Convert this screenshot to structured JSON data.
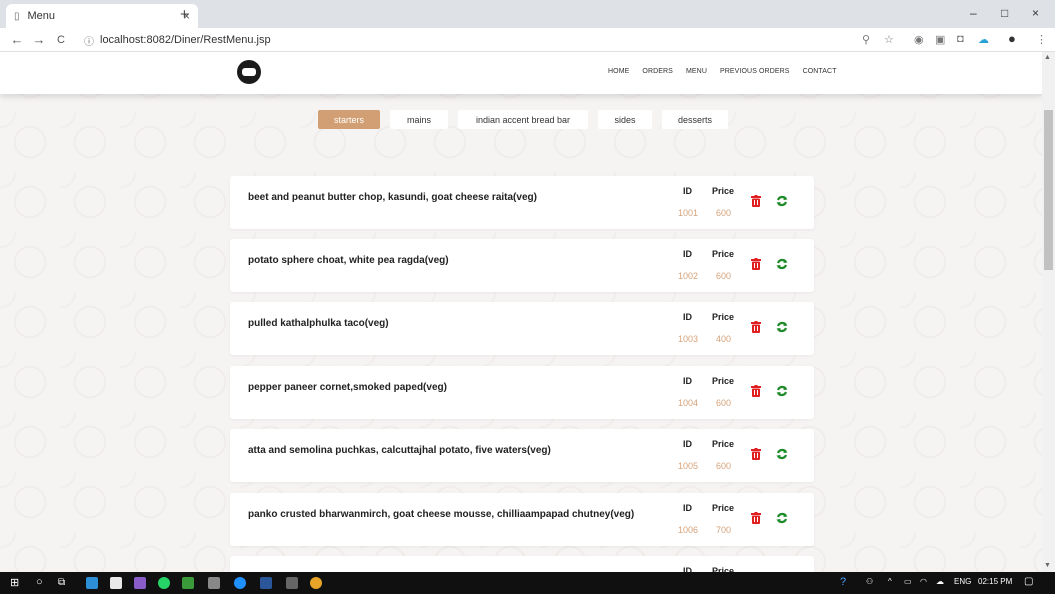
{
  "browser": {
    "tab_title": "Menu",
    "tab_close": "×",
    "new_tab": "+",
    "back": "←",
    "forward": "→",
    "reload": "C",
    "url": "localhost:8082/Diner/RestMenu.jsp",
    "window_min": "–",
    "window_max": "□",
    "window_close": "×"
  },
  "nav": {
    "links": [
      "HOME",
      "ORDERS",
      "MENU",
      "PREVIOUS ORDERS",
      "CONTACT"
    ]
  },
  "categories": [
    {
      "label": "starters",
      "active": true
    },
    {
      "label": "mains",
      "active": false
    },
    {
      "label": "indian accent bread bar",
      "active": false
    },
    {
      "label": "sides",
      "active": false
    },
    {
      "label": "desserts",
      "active": false
    }
  ],
  "columns": {
    "id": "ID",
    "price": "Price"
  },
  "items": [
    {
      "name": "beet and peanut butter chop, kasundi, goat cheese raita(veg)",
      "id": "1001",
      "price": "600"
    },
    {
      "name": "potato sphere choat, white pea ragda(veg)",
      "id": "1002",
      "price": "600"
    },
    {
      "name": "pulled kathalphulka taco(veg)",
      "id": "1003",
      "price": "400"
    },
    {
      "name": "pepper paneer cornet,smoked paped(veg)",
      "id": "1004",
      "price": "600"
    },
    {
      "name": "atta and semolina puchkas, calcuttajhal potato, five waters(veg)",
      "id": "1005",
      "price": "600"
    },
    {
      "name": "panko crusted bharwanmirch, goat cheese mousse, chilliaampapad chutney(veg)",
      "id": "1006",
      "price": "700"
    }
  ],
  "taskbar": {
    "language": "ENG",
    "time": "02:15 PM"
  },
  "colors": {
    "accent": "#d19f73",
    "value_text": "#d4a27a",
    "delete_red": "#e02020",
    "update_green": "#1f8a2a"
  }
}
